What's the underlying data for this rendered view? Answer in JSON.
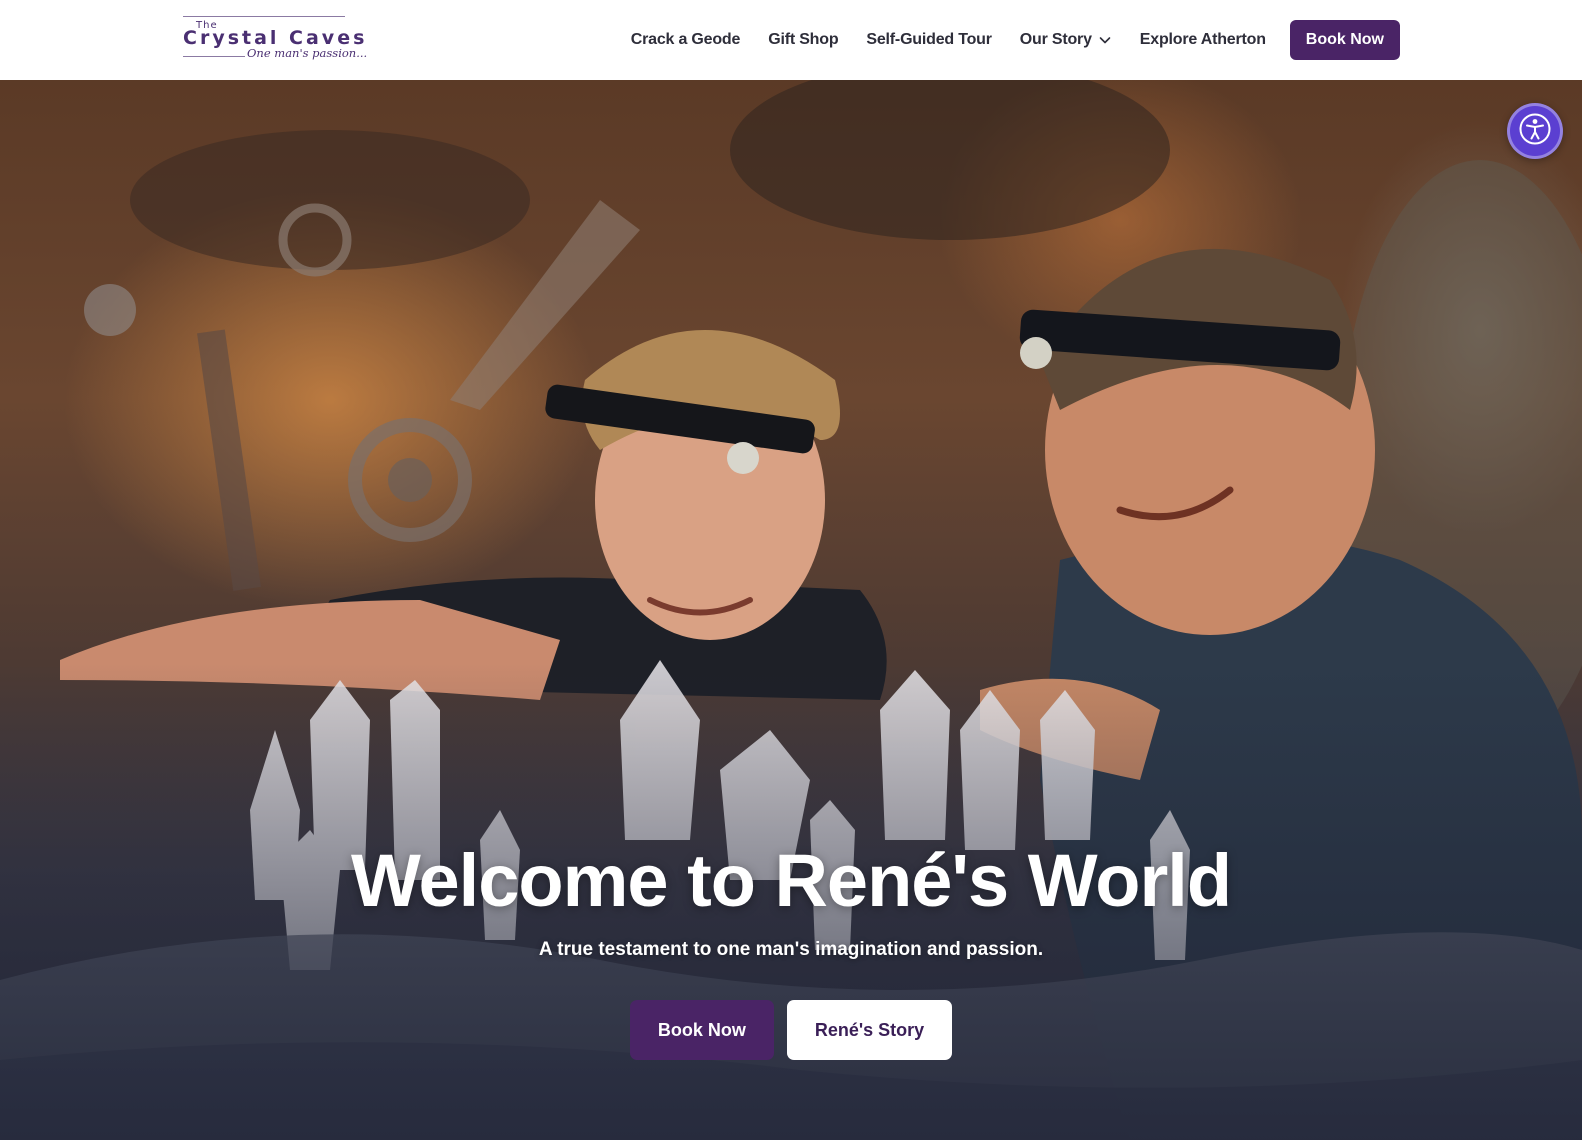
{
  "brand": {
    "logo_the": "The",
    "logo_name": "Crystal Caves",
    "logo_tagline": "One man's passion..."
  },
  "nav": {
    "items": [
      {
        "label": "Crack a Geode"
      },
      {
        "label": "Gift Shop"
      },
      {
        "label": "Self-Guided Tour"
      },
      {
        "label": "Our Story",
        "has_dropdown": true
      },
      {
        "label": "Explore Atherton"
      }
    ],
    "book_label": "Book Now"
  },
  "hero": {
    "title": "Welcome to René's World",
    "subtitle": "A true testament to one man's imagination and passion.",
    "primary_button": "Book Now",
    "secondary_button": "René's Story"
  },
  "accessibility": {
    "icon": "accessibility-icon"
  },
  "colors": {
    "brand_purple": "#4a2466",
    "accessibility_blue": "#5b3fd1",
    "nav_text": "#2e2e3a"
  }
}
